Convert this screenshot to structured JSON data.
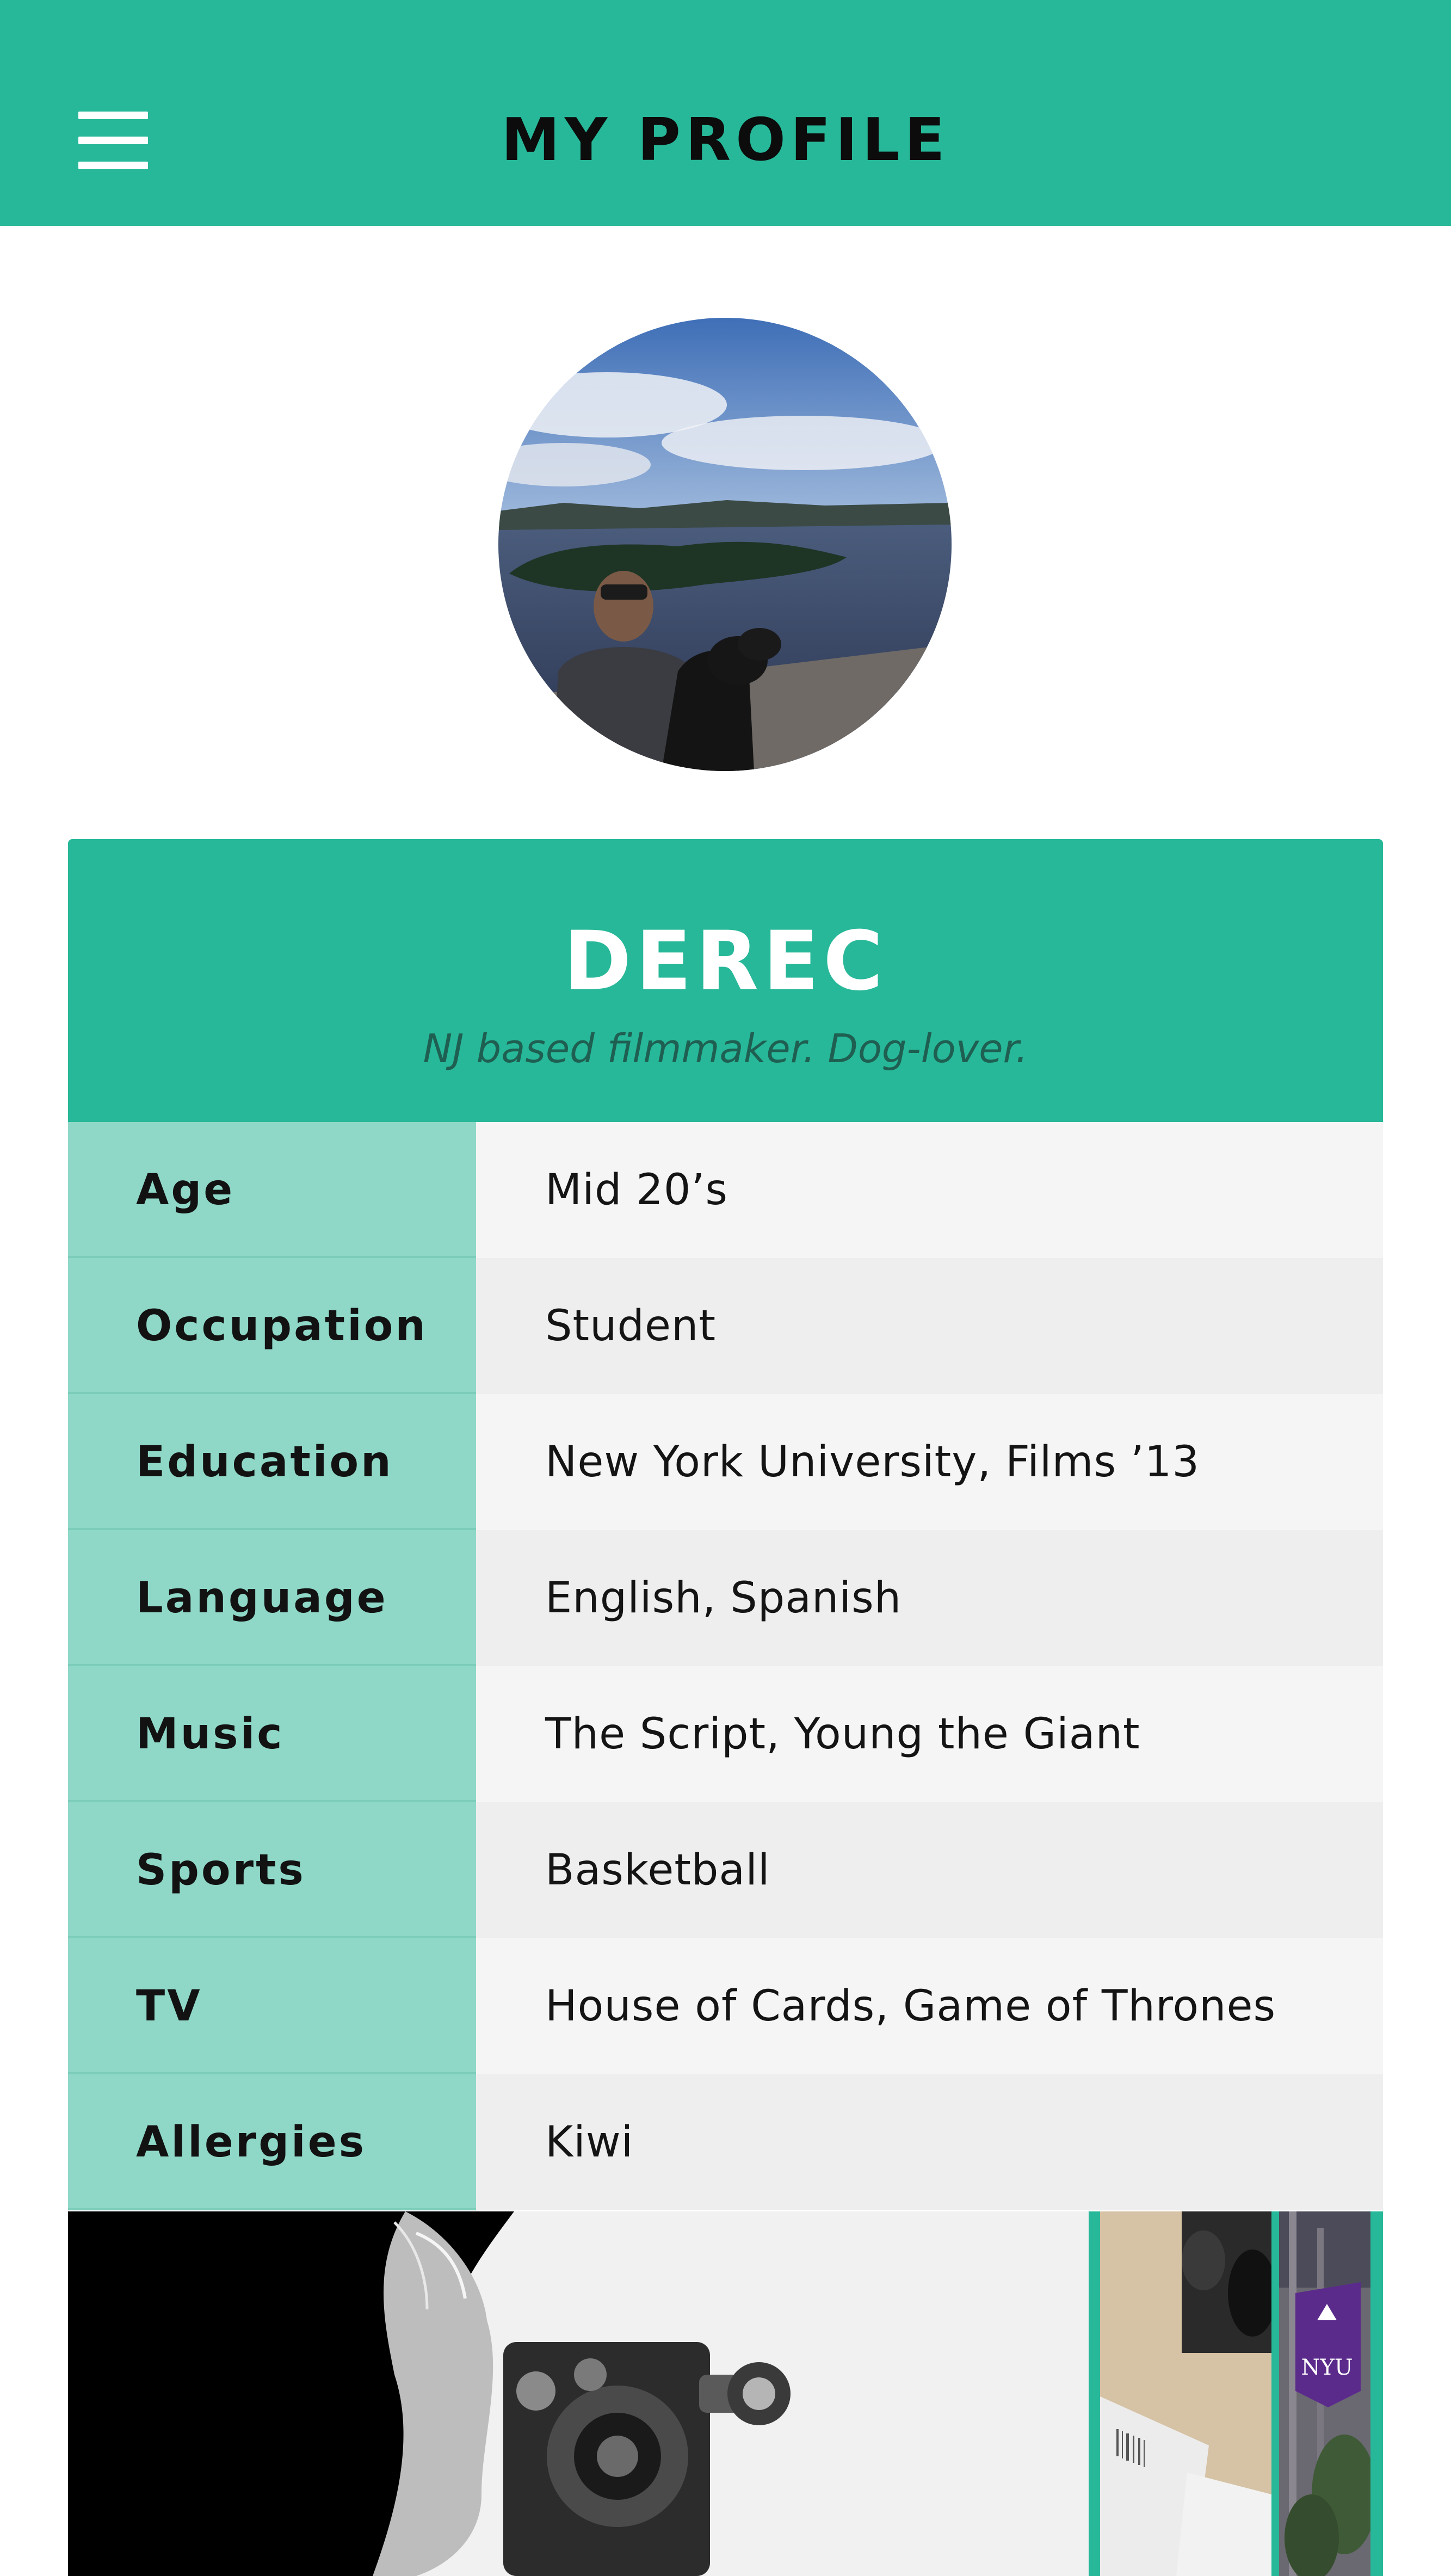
{
  "header": {
    "title": "MY PROFILE",
    "menu_icon": "hamburger-menu-icon",
    "background": "#27b899"
  },
  "profile": {
    "name": "DEREC",
    "bio": "NJ based filmmaker. Dog-lover."
  },
  "details": [
    {
      "label": "Age",
      "value": "Mid 20’s"
    },
    {
      "label": "Occupation",
      "value": "Student"
    },
    {
      "label": "Education",
      "value": "New York University, Films ’13"
    },
    {
      "label": "Language",
      "value": "English, Spanish"
    },
    {
      "label": "Music",
      "value": "The Script, Young the Giant"
    },
    {
      "label": "Sports",
      "value": "Basketball"
    },
    {
      "label": "TV",
      "value": "House of Cards, Game of Thrones"
    },
    {
      "label": "Allergies",
      "value": "Kiwi"
    }
  ],
  "gallery": {
    "banner_text": "NYU"
  },
  "colors": {
    "accent": "#27b899",
    "label_bg": "#8fd8c8"
  }
}
